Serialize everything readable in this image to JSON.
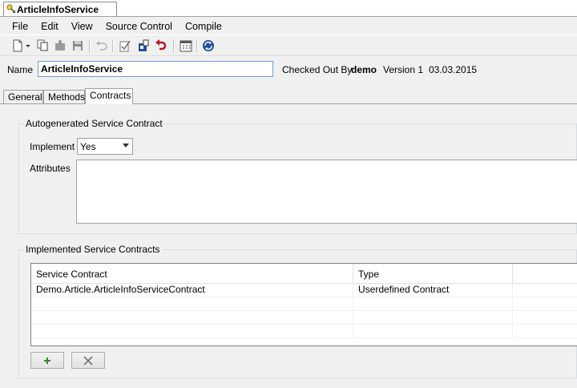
{
  "document_tab": {
    "title": "ArticleInfoService"
  },
  "menu": [
    "File",
    "Edit",
    "View",
    "Source Control",
    "Compile"
  ],
  "toolbar": {
    "icons": [
      "new-document-icon",
      "copy-icon",
      "puzzle-icon",
      "save-icon",
      "undo-icon",
      "checkout-icon",
      "checkin-icon",
      "undo-checkout-icon",
      "calendar-icon",
      "refresh-icon"
    ]
  },
  "header": {
    "name_label": "Name",
    "name_value": "ArticleInfoService",
    "checked_out_label": "Checked Out By",
    "checked_out_user": "demo",
    "version": "Version 1",
    "date": "03.03.2015"
  },
  "tabs": [
    {
      "label": "General",
      "active": false
    },
    {
      "label": "Methods",
      "active": false
    },
    {
      "label": "Contracts",
      "active": true
    }
  ],
  "autogenerated": {
    "title": "Autogenerated Service Contract",
    "implement_label": "Implement",
    "implement_value": "Yes",
    "attributes_label": "Attributes",
    "attributes_value": ""
  },
  "implemented": {
    "title": "Implemented Service Contracts",
    "columns": [
      "Service Contract",
      "Type"
    ],
    "rows": [
      [
        "Demo.Article.ArticleInfoServiceContract",
        "Userdefined Contract"
      ]
    ]
  },
  "colors": {
    "accent": "#6f9fd1",
    "add_green": "#2e8b2e",
    "undo_red": "#c0141e",
    "blue": "#1f4fa0"
  }
}
